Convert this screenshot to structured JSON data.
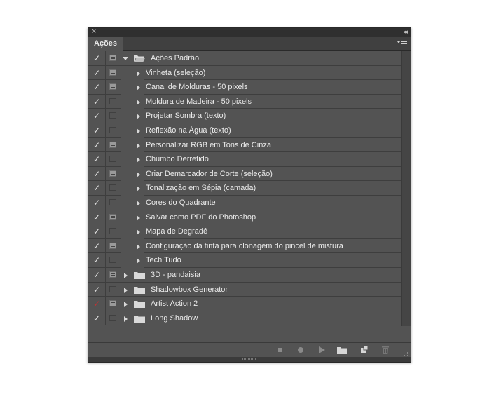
{
  "panel": {
    "tab_label": "Ações",
    "close_glyph": "×",
    "collapse_glyph": "◂◂"
  },
  "actions": [
    {
      "label": "Ações Padrão",
      "type": "set",
      "expanded": true,
      "enabled": true,
      "dialog": true
    },
    {
      "label": "Vinheta (seleção)",
      "type": "action",
      "enabled": true,
      "dialog": true
    },
    {
      "label": "Canal de Molduras - 50 pixels",
      "type": "action",
      "enabled": true,
      "dialog": true
    },
    {
      "label": "Moldura de Madeira - 50 pixels",
      "type": "action",
      "enabled": true,
      "dialog": false
    },
    {
      "label": "Projetar Sombra (texto)",
      "type": "action",
      "enabled": true,
      "dialog": false
    },
    {
      "label": "Reflexão na Água (texto)",
      "type": "action",
      "enabled": true,
      "dialog": false
    },
    {
      "label": "Personalizar RGB em Tons de Cinza",
      "type": "action",
      "enabled": true,
      "dialog": true
    },
    {
      "label": "Chumbo Derretido",
      "type": "action",
      "enabled": true,
      "dialog": false
    },
    {
      "label": "Criar Demarcador de Corte (seleção)",
      "type": "action",
      "enabled": true,
      "dialog": true
    },
    {
      "label": "Tonalização em Sépia (camada)",
      "type": "action",
      "enabled": true,
      "dialog": false
    },
    {
      "label": "Cores do Quadrante",
      "type": "action",
      "enabled": true,
      "dialog": false
    },
    {
      "label": "Salvar como PDF do Photoshop",
      "type": "action",
      "enabled": true,
      "dialog": true
    },
    {
      "label": "Mapa de Degradê",
      "type": "action",
      "enabled": true,
      "dialog": false
    },
    {
      "label": "Configuração da tinta para clonagem do pincel de mistura",
      "type": "action",
      "enabled": true,
      "dialog": true
    },
    {
      "label": "Tech Tudo",
      "type": "action",
      "enabled": true,
      "dialog": false
    },
    {
      "label": "3D - pandaisia",
      "type": "set",
      "expanded": false,
      "enabled": true,
      "dialog": true
    },
    {
      "label": "Shadowbox Generator",
      "type": "set",
      "expanded": false,
      "enabled": true,
      "dialog": false
    },
    {
      "label": "Artist Action 2",
      "type": "set",
      "expanded": false,
      "enabled": true,
      "partial": true,
      "dialog": true
    },
    {
      "label": "Long Shadow",
      "type": "set",
      "expanded": false,
      "enabled": true,
      "dialog": false
    }
  ],
  "toolbar": {
    "icons": [
      "stop-icon",
      "record-icon",
      "play-icon",
      "new-set-icon",
      "new-action-icon",
      "delete-icon"
    ]
  },
  "colors": {
    "panel_bg": "#535353",
    "text": "#eaeaea",
    "partial_check": "#c83030"
  }
}
